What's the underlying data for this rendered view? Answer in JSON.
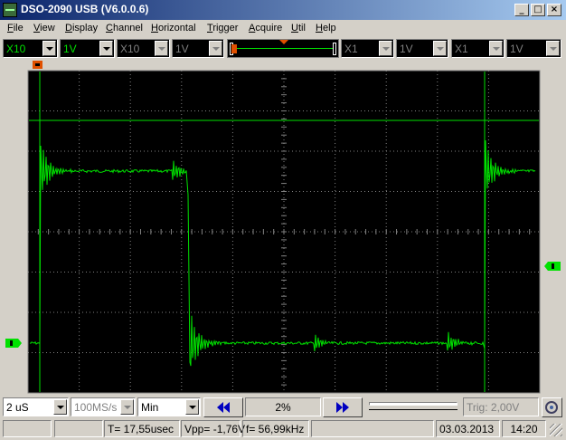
{
  "window": {
    "title": "DSO-2090 USB (V6.0.0.6)"
  },
  "menu": [
    "File",
    "View",
    "Display",
    "Channel",
    "Horizontal",
    "Trigger",
    "Acquire",
    "Util",
    "Help"
  ],
  "toolbar": {
    "ch1_probe": "X10",
    "ch1_volts": "1V",
    "ch2_probe": "X10",
    "ch2_volts": "1V",
    "ch3_probe": "X1",
    "ch3_volts": "1V",
    "ch4_probe": "X1",
    "ch4_volts": "1V"
  },
  "bottom": {
    "timebase": "2 uS",
    "sample_rate": "100MS/s",
    "mode": "Min",
    "position_percent": "2%",
    "trigger": "Trig: 2,00V"
  },
  "status": {
    "period": "T= 17,55usec",
    "vpp": "Vpp= -1,76V",
    "frequency": "f= 56,99kHz",
    "date": "03.03.2013",
    "time": "14:20"
  },
  "colors": {
    "trace": "#00e000",
    "grid": "#808080",
    "screen_bg": "#000000"
  }
}
